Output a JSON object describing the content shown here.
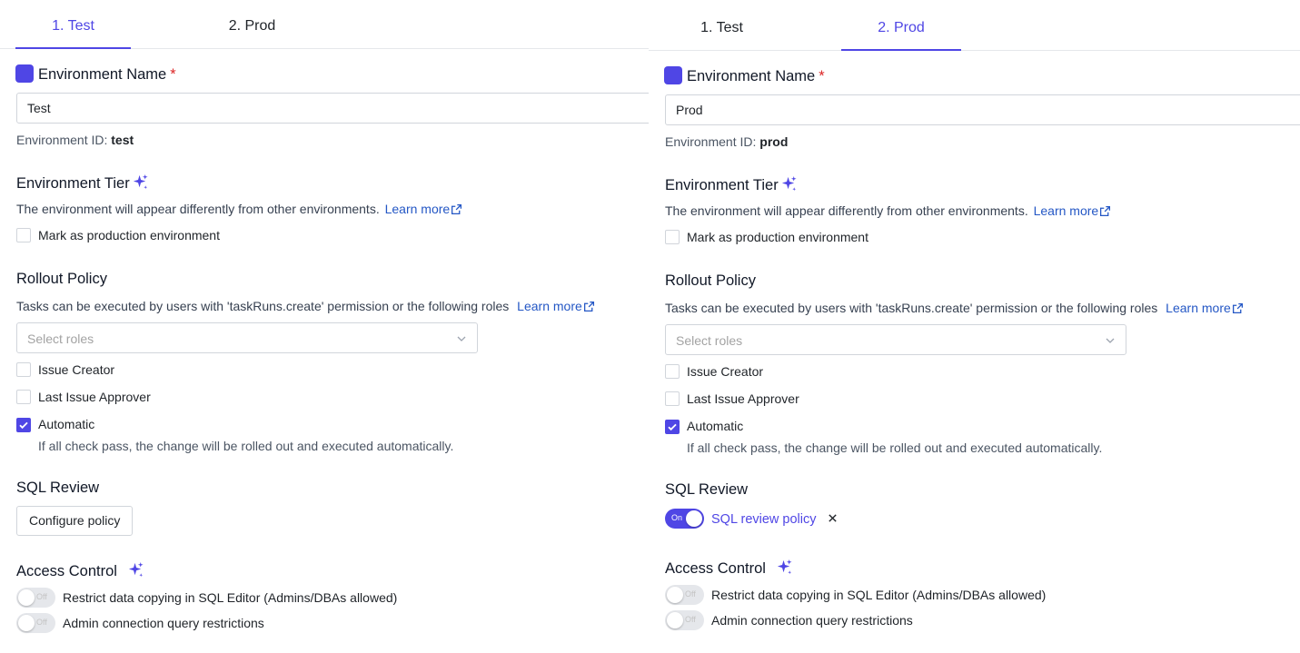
{
  "left": {
    "tabs": [
      {
        "label": "1. Test"
      },
      {
        "label": "2. Prod"
      }
    ],
    "env_name": {
      "title": "Environment Name",
      "required_mark": "*",
      "value": "Test",
      "id_label": "Environment ID:",
      "id_value": "test"
    },
    "tier": {
      "title": "Environment Tier",
      "description": "The environment will appear differently from other environments.",
      "learn_more": "Learn more",
      "production_label": "Mark as production environment",
      "production_checked": false
    },
    "rollout": {
      "title": "Rollout Policy",
      "description": "Tasks can be executed by users with 'taskRuns.create' permission or the following roles",
      "learn_more": "Learn more",
      "select_placeholder": "Select roles",
      "options": [
        {
          "label": "Issue Creator",
          "checked": false
        },
        {
          "label": "Last Issue Approver",
          "checked": false
        },
        {
          "label": "Automatic",
          "checked": true
        }
      ],
      "automatic_hint": "If all check pass, the change will be rolled out and executed automatically."
    },
    "sql_review": {
      "title": "SQL Review",
      "button_label": "Configure policy"
    },
    "access": {
      "title": "Access Control",
      "toggles": [
        {
          "label": "Restrict data copying in SQL Editor (Admins/DBAs allowed)",
          "state": "Off"
        },
        {
          "label": "Admin connection query restrictions",
          "state": "Off"
        }
      ]
    }
  },
  "right": {
    "tabs": [
      {
        "label": "1. Test"
      },
      {
        "label": "2. Prod"
      }
    ],
    "env_name": {
      "title": "Environment Name",
      "required_mark": "*",
      "value": "Prod",
      "id_label": "Environment ID:",
      "id_value": "prod"
    },
    "tier": {
      "title": "Environment Tier",
      "description": "The environment will appear differently from other environments.",
      "learn_more": "Learn more",
      "production_label": "Mark as production environment",
      "production_checked": false
    },
    "rollout": {
      "title": "Rollout Policy",
      "description": "Tasks can be executed by users with 'taskRuns.create' permission or the following roles",
      "learn_more": "Learn more",
      "select_placeholder": "Select roles",
      "options": [
        {
          "label": "Issue Creator",
          "checked": false
        },
        {
          "label": "Last Issue Approver",
          "checked": false
        },
        {
          "label": "Automatic",
          "checked": true
        }
      ],
      "automatic_hint": "If all check pass, the change will be rolled out and executed automatically."
    },
    "sql_review": {
      "title": "SQL Review",
      "toggle_state": "On",
      "policy_link": "SQL review policy"
    },
    "access": {
      "title": "Access Control",
      "toggles": [
        {
          "label": "Restrict data copying in SQL Editor (Admins/DBAs allowed)",
          "state": "Off"
        },
        {
          "label": "Admin connection query restrictions",
          "state": "Off"
        }
      ]
    }
  },
  "colors": {
    "accent": "#4f46e5",
    "link": "#2457c5",
    "required": "#dc2626",
    "sparkle": "#4f46e5"
  }
}
